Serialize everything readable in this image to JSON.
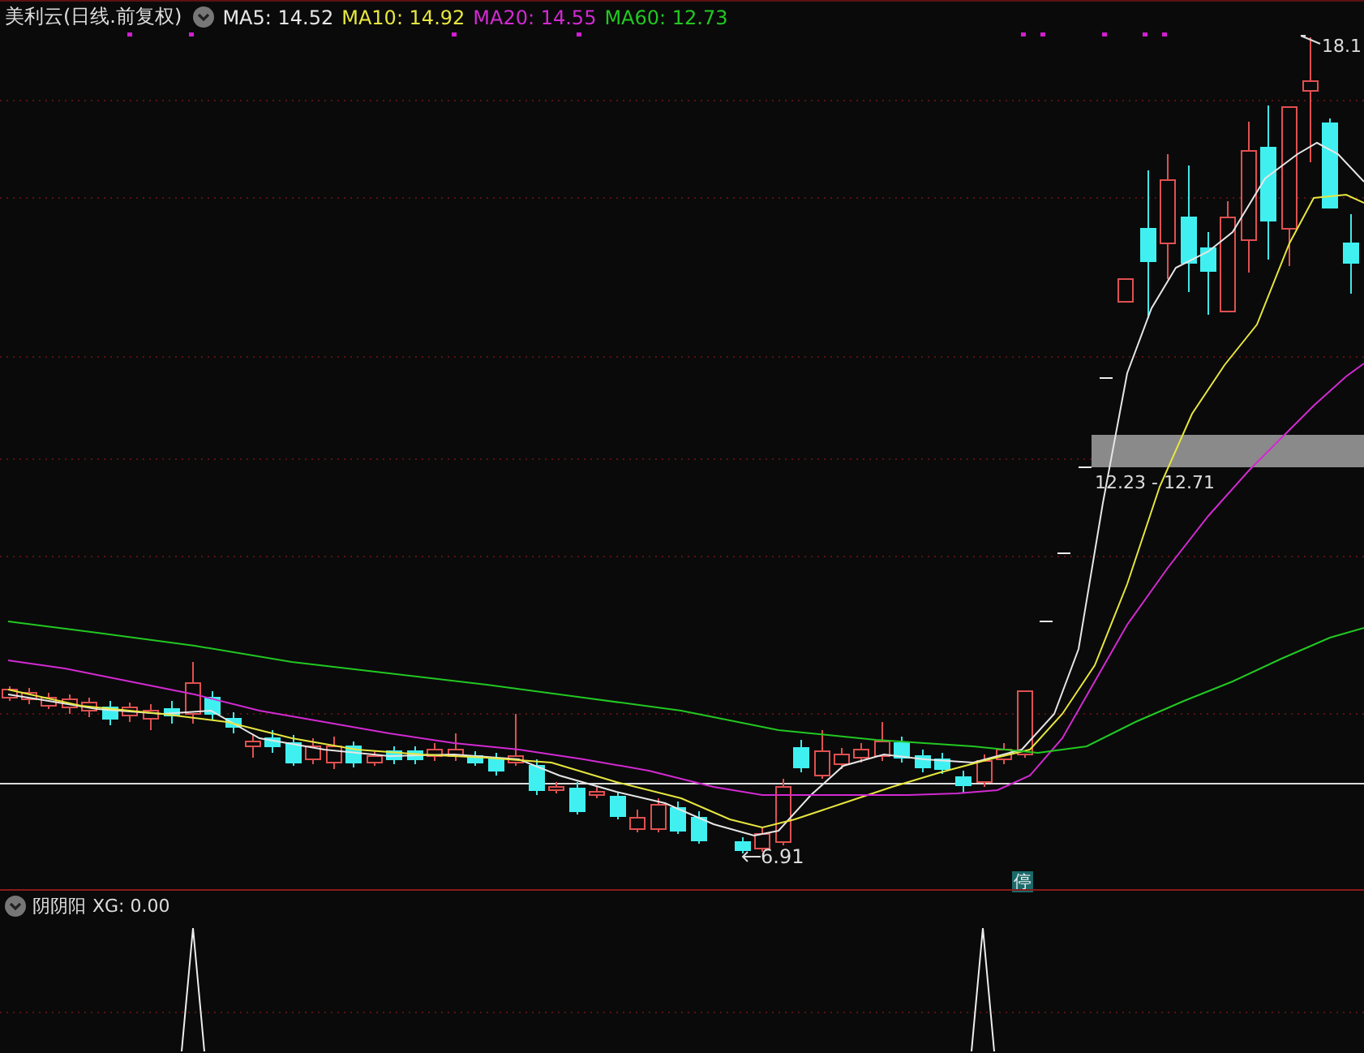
{
  "chart_header": {
    "title": "美利云(日线.前复权)",
    "ma_legend": [
      {
        "label": "MA5: 14.52",
        "color": "#e6e6e6"
      },
      {
        "label": "MA10: 14.92",
        "color": "#e6e640"
      },
      {
        "label": "MA20: 14.55",
        "color": "#d22ad2"
      },
      {
        "label": "MA60: 12.73",
        "color": "#22c822"
      }
    ]
  },
  "price_chart": {
    "high_label": "18.1",
    "low_label": "6.91",
    "range_label": "12.23 - 12.71",
    "badge": "停"
  },
  "indicator_panel": {
    "name": "阴阴阳",
    "value": "XG: 0.00"
  }
}
